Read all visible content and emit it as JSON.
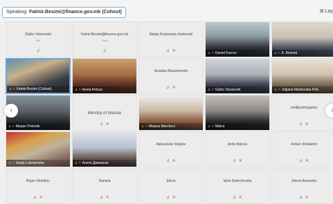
{
  "speaking": {
    "prefix": "Speaking:",
    "name": "Fatmir.Besimi@finance.gov.mk (Cohost)"
  },
  "layout_label": "Lay",
  "tiles": [
    {
      "name": "Zlatko Veterovski",
      "sub": "Me",
      "type": "name"
    },
    {
      "name": "Fatmir.Besimi@finance.gov.mk",
      "sub": "Host",
      "type": "name"
    },
    {
      "name": "Marija Koskovska Jankovski",
      "type": "name"
    },
    {
      "name": "Daniel Kurcev",
      "type": "video"
    },
    {
      "name": "A. Besheti",
      "type": "video"
    },
    {
      "name": "Fatmir.Besimi (Cohost)",
      "type": "video",
      "active": true
    },
    {
      "name": "Anela Antova",
      "type": "video"
    },
    {
      "name": "Anastas Mazenkovski",
      "type": "name"
    },
    {
      "name": "Gjoko Tanasoski",
      "type": "video"
    },
    {
      "name": "Julijana Markovska Petr...",
      "type": "video"
    },
    {
      "name": "Marjan Petreski",
      "type": "video"
    },
    {
      "name": "Ministry of finance",
      "type": "center"
    },
    {
      "name": "Mirjana Marchevi",
      "type": "video"
    },
    {
      "name": "Nikica",
      "type": "video"
    },
    {
      "name": "emilija.belogaska",
      "type": "name"
    },
    {
      "name": "Sanja Lukovenska",
      "type": "video"
    },
    {
      "name": "Анета Димовска",
      "type": "video"
    },
    {
      "name": "Aleksandar Stojkov",
      "type": "name"
    },
    {
      "name": "Anita Nikova",
      "type": "name"
    },
    {
      "name": "Ardian Xhelaidini",
      "type": "name"
    },
    {
      "name": "Bojan Shimbov",
      "type": "name"
    },
    {
      "name": "Daniela",
      "type": "name"
    },
    {
      "name": "Elena",
      "type": "name"
    },
    {
      "name": "Iskra Damchevska",
      "type": "name"
    },
    {
      "name": "Jelena Arsovska",
      "type": "name"
    }
  ],
  "icons": {
    "mic_off": "mic-off-icon",
    "camera_off": "camera-off-icon",
    "speaker": "speaker-icon"
  },
  "colors": {
    "active_border": "#6aa0d8",
    "mute_red": "#d8423a",
    "speaking_border": "#7fb2d6"
  }
}
